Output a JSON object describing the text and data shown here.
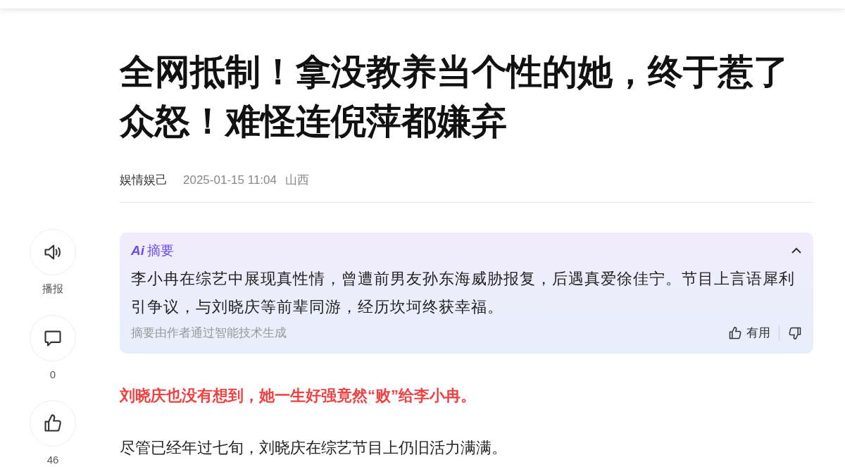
{
  "article": {
    "title": "全网抵制！拿没教养当个性的她，终于惹了众怒！难怪连倪萍都嫌弃",
    "author": "娱情娱己",
    "time": "2025-01-15 11:04",
    "location": "山西"
  },
  "side_actions": [
    {
      "kind": "listen",
      "label": "播报"
    },
    {
      "kind": "comment",
      "label": "0"
    },
    {
      "kind": "like",
      "label": "46"
    }
  ],
  "summary": {
    "badge": "Ai",
    "heading": "摘要",
    "expanded": true,
    "text": "李小冉在综艺中展现真性情，曾遭前男友孙东海威胁报复，后遇真爱徐佳宁。节目上言语犀利引争议，与刘晓庆等前辈同游，经历坎坷终获幸福。",
    "note": "摘要由作者通过智能技术生成",
    "useful": "有用"
  },
  "body": [
    {
      "kind": "highlight",
      "text": "刘晓庆也没有想到，她一生好强竟然“败”给李小冉。"
    },
    {
      "kind": "plain",
      "text": "尽管已经年过七旬，刘晓庆在综艺节目上仍旧活力满满。"
    }
  ]
}
